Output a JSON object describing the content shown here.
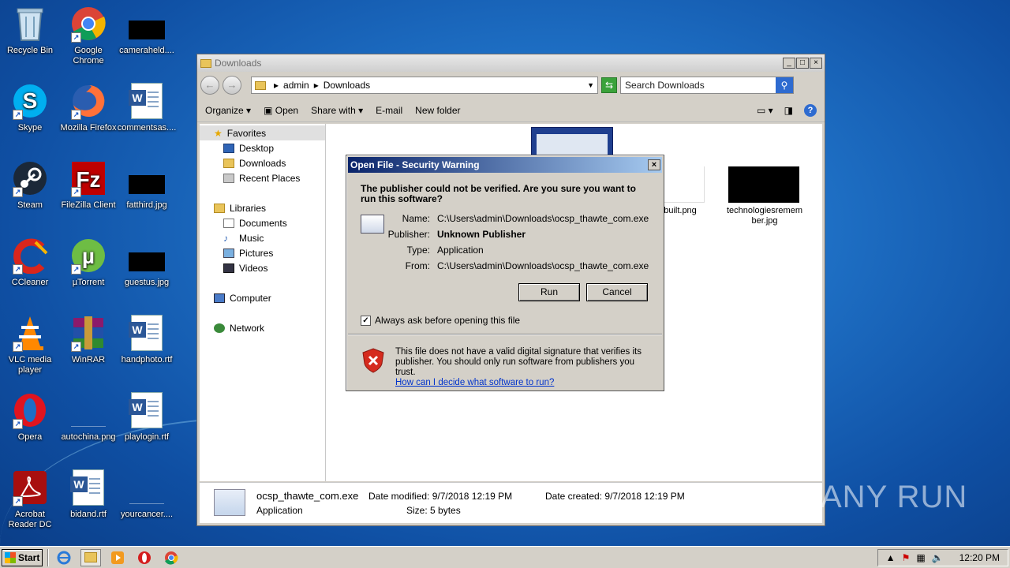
{
  "desktop": {
    "icons": [
      {
        "label": "Recycle Bin",
        "name": "recycle-bin-icon"
      },
      {
        "label": "Google Chrome",
        "name": "chrome-icon"
      },
      {
        "label": "cameraheld....",
        "name": "file-redacted-icon"
      },
      {
        "label": "Skype",
        "name": "skype-icon"
      },
      {
        "label": "Mozilla Firefox",
        "name": "firefox-icon"
      },
      {
        "label": "commentsas....",
        "name": "word-doc-icon"
      },
      {
        "label": "Steam",
        "name": "steam-icon"
      },
      {
        "label": "FileZilla Client",
        "name": "filezilla-icon"
      },
      {
        "label": "fatthird.jpg",
        "name": "file-redacted-icon"
      },
      {
        "label": "CCleaner",
        "name": "ccleaner-icon"
      },
      {
        "label": "µTorrent",
        "name": "utorrent-icon"
      },
      {
        "label": "guestus.jpg",
        "name": "file-redacted-icon"
      },
      {
        "label": "VLC media player",
        "name": "vlc-icon"
      },
      {
        "label": "WinRAR",
        "name": "winrar-icon"
      },
      {
        "label": "handphoto.rtf",
        "name": "word-doc-icon"
      },
      {
        "label": "Opera",
        "name": "opera-icon"
      },
      {
        "label": "autochina.png",
        "name": "image-file-icon"
      },
      {
        "label": "playlogin.rtf",
        "name": "word-doc-icon"
      },
      {
        "label": "Acrobat Reader DC",
        "name": "acrobat-icon"
      },
      {
        "label": "bidand.rtf",
        "name": "word-doc-icon"
      },
      {
        "label": "yourcancer....",
        "name": "image-file-icon"
      }
    ]
  },
  "explorer": {
    "title": "Downloads",
    "breadcrumb": [
      "admin",
      "Downloads"
    ],
    "search_placeholder": "Search Downloads",
    "toolbar": {
      "organize": "Organize",
      "open": "Open",
      "share_with": "Share with",
      "email": "E-mail",
      "new_folder": "New folder"
    },
    "nav": {
      "favorites": "Favorites",
      "desktop": "Desktop",
      "downloads": "Downloads",
      "recent_places": "Recent Places",
      "libraries": "Libraries",
      "documents": "Documents",
      "music": "Music",
      "pictures": "Pictures",
      "videos": "Videos",
      "computer": "Computer",
      "network": "Network"
    },
    "files": {
      "file1": "built.png",
      "file2": "technologiesremember.jpg"
    },
    "details": {
      "filename": "ocsp_thawte_com.exe",
      "type": "Application",
      "date_modified_label": "Date modified:",
      "date_modified": "9/7/2018 12:19 PM",
      "size_label": "Size:",
      "size": "5 bytes",
      "date_created_label": "Date created:",
      "date_created": "9/7/2018 12:19 PM"
    }
  },
  "dialog": {
    "title": "Open File - Security Warning",
    "question": "The publisher could not be verified.  Are you sure you want to run this software?",
    "fields": {
      "name_label": "Name:",
      "name": "C:\\Users\\admin\\Downloads\\ocsp_thawte_com.exe",
      "publisher_label": "Publisher:",
      "publisher": "Unknown Publisher",
      "type_label": "Type:",
      "type": "Application",
      "from_label": "From:",
      "from": "C:\\Users\\admin\\Downloads\\ocsp_thawte_com.exe"
    },
    "run_button": "Run",
    "cancel_button": "Cancel",
    "checkbox_label": "Always ask before opening this file",
    "checkbox_checked": true,
    "warning_text": "This file does not have a valid digital signature that verifies its publisher.  You should only run software from publishers you trust.",
    "warning_link": "How can I decide what software to run?"
  },
  "watermark": "ANY RUN",
  "taskbar": {
    "start": "Start",
    "clock": "12:20 PM"
  }
}
